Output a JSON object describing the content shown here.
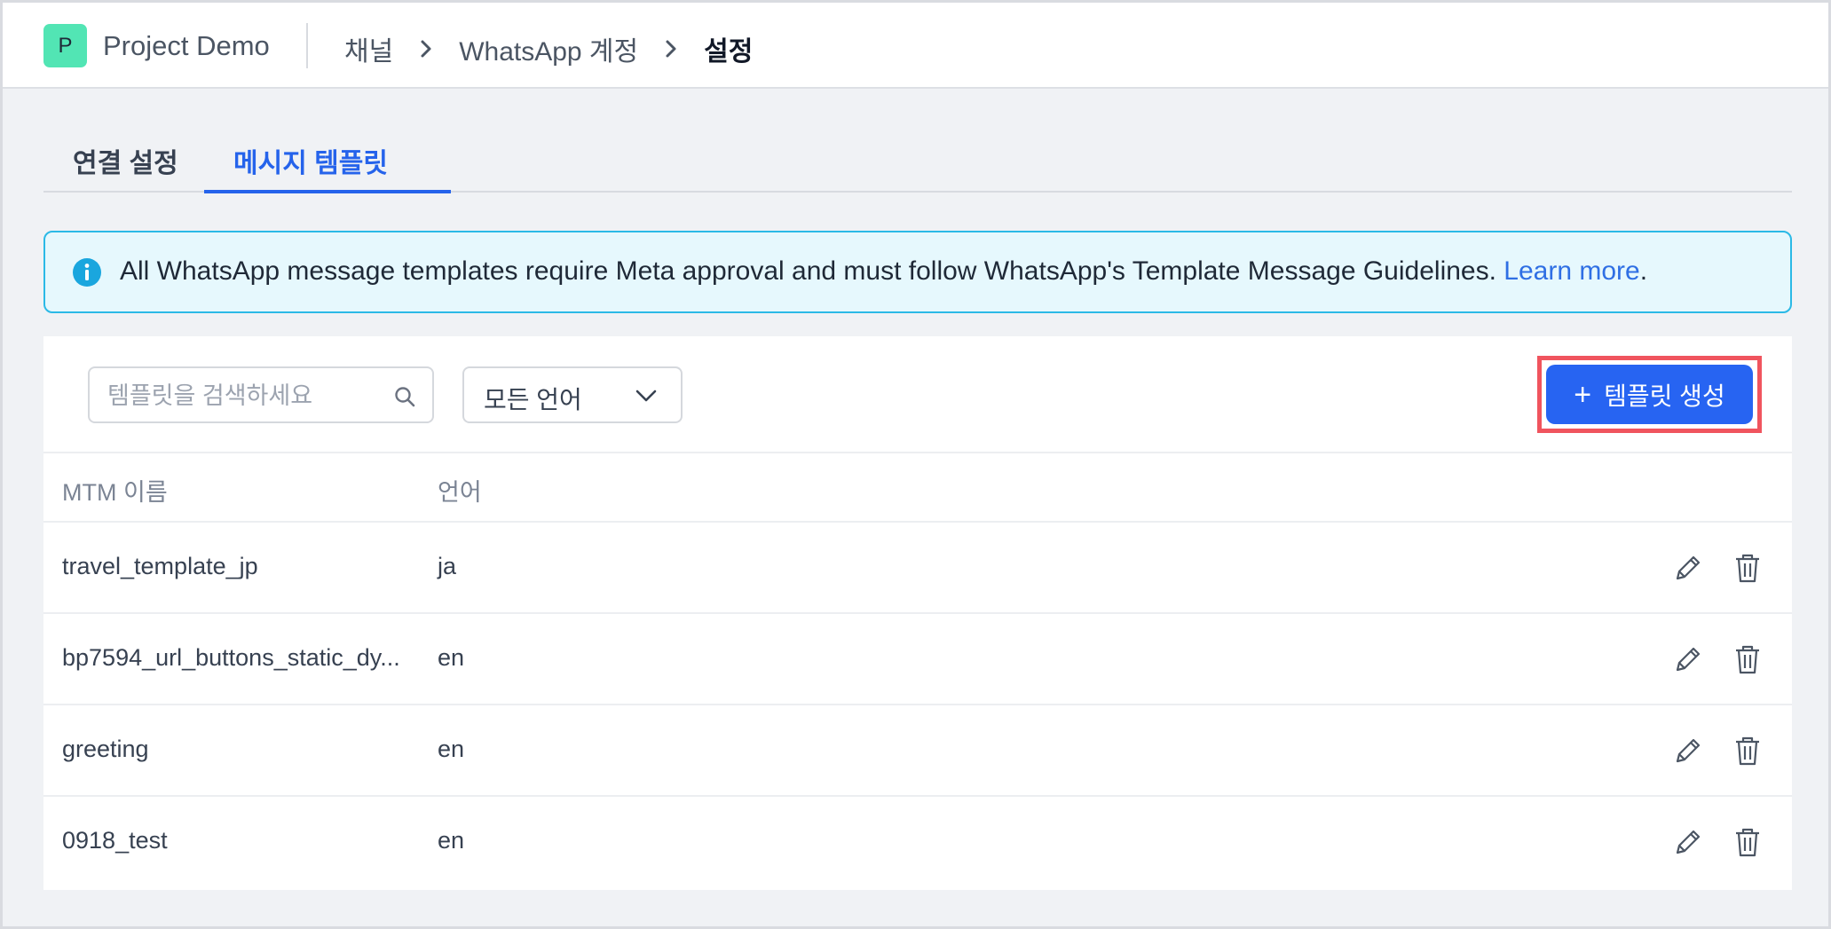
{
  "header": {
    "project_initial": "P",
    "project_name": "Project Demo",
    "breadcrumb": [
      "채널",
      "WhatsApp 계정",
      "설정"
    ]
  },
  "tabs": [
    {
      "label": "연결 설정",
      "active": false
    },
    {
      "label": "메시지 템플릿",
      "active": true
    }
  ],
  "info": {
    "text": "All WhatsApp message templates require Meta approval and must follow WhatsApp's Template Message Guidelines. ",
    "link": "Learn more",
    "suffix": "."
  },
  "toolbar": {
    "search_placeholder": "템플릿을 검색하세요",
    "language_value": "모든 언어",
    "create_label": "템플릿 생성"
  },
  "table": {
    "columns": [
      "MTM 이름",
      "언어"
    ],
    "rows": [
      {
        "name": "travel_template_jp",
        "lang": "ja"
      },
      {
        "name": "bp7594_url_buttons_static_dy...",
        "lang": "en"
      },
      {
        "name": "greeting",
        "lang": "en"
      },
      {
        "name": "0918_test",
        "lang": "en"
      }
    ]
  },
  "colors": {
    "accent": "#2764f2",
    "badge": "#52e5b4",
    "highlight": "#f0545e",
    "info_border": "#2bb9e6"
  }
}
